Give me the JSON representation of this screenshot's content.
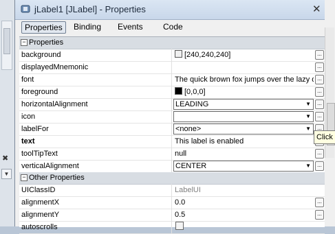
{
  "window": {
    "title": "jLabel1 [JLabel] - Properties",
    "close_glyph": "✕"
  },
  "tabs": [
    {
      "label": "Properties",
      "active": true
    },
    {
      "label": "Binding",
      "active": false
    },
    {
      "label": "Events",
      "active": false
    },
    {
      "label": "Code",
      "active": false
    }
  ],
  "categories": {
    "properties": "Properties",
    "other": "Other Properties"
  },
  "props": {
    "background": {
      "name": "background",
      "value": "[240,240,240]",
      "swatch": "#f0f0f0"
    },
    "displayedMnemonic": {
      "name": "displayedMnemonic",
      "value": ""
    },
    "font": {
      "name": "font",
      "value": "The quick brown fox jumps over the lazy d"
    },
    "foreground": {
      "name": "foreground",
      "value": "[0,0,0]",
      "swatch": "#000000"
    },
    "horizontalAlignment": {
      "name": "horizontalAlignment",
      "value": "LEADING"
    },
    "icon": {
      "name": "icon",
      "value": ""
    },
    "labelFor": {
      "name": "labelFor",
      "value": "<none>"
    },
    "text": {
      "name": "text",
      "value": "This label is enabled"
    },
    "toolTipText": {
      "name": "toolTipText",
      "value": "null"
    },
    "verticalAlignment": {
      "name": "verticalAlignment",
      "value": "CENTER"
    },
    "UIClassID": {
      "name": "UIClassID",
      "value": "LabelUI"
    },
    "alignmentX": {
      "name": "alignmentX",
      "value": "0.0"
    },
    "alignmentY": {
      "name": "alignmentY",
      "value": "0.5"
    },
    "autoscrolls": {
      "name": "autoscrolls",
      "value": ""
    }
  },
  "ellipsis": "...",
  "tooltip": "Click",
  "side": {
    "close_glyph": "✖"
  }
}
